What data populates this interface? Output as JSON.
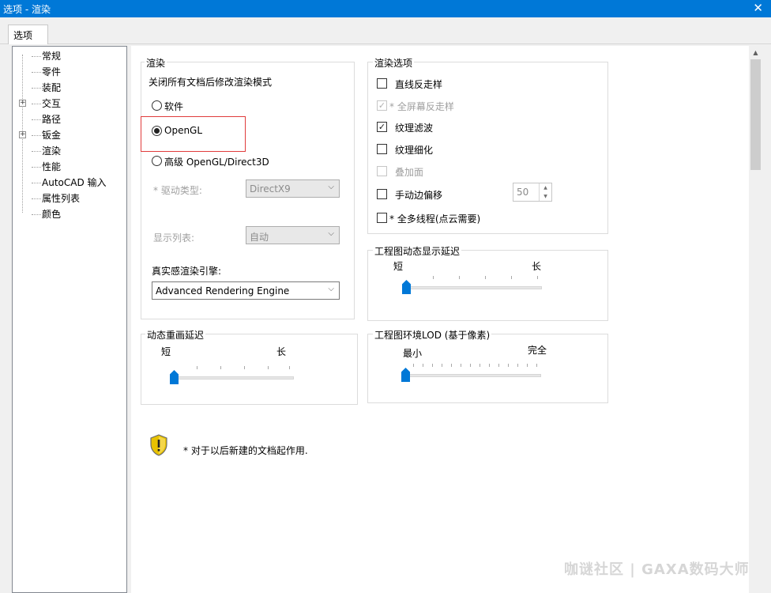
{
  "window": {
    "title": "选项 - 渲染",
    "close_glyph": "✕"
  },
  "tabs": [
    {
      "label": "选项"
    }
  ],
  "tree": {
    "items": [
      {
        "label": "常规",
        "expandable": false
      },
      {
        "label": "零件",
        "expandable": false
      },
      {
        "label": "装配",
        "expandable": false
      },
      {
        "label": "交互",
        "expandable": true
      },
      {
        "label": "路径",
        "expandable": false
      },
      {
        "label": "钣金",
        "expandable": true
      },
      {
        "label": "渲染",
        "expandable": false
      },
      {
        "label": "性能",
        "expandable": false
      },
      {
        "label": "AutoCAD 输入",
        "expandable": false
      },
      {
        "label": "属性列表",
        "expandable": false
      },
      {
        "label": "颜色",
        "expandable": false
      }
    ],
    "expander_glyph": "+"
  },
  "render_group": {
    "title": "渲染",
    "subtitle": "关闭所有文档后修改渲染模式",
    "radio_software": "软件",
    "radio_opengl": "OpenGL",
    "radio_advanced": "高级 OpenGL/Direct3D",
    "selected": "OpenGL",
    "driver_label": "* 驱动类型:",
    "driver_value": "DirectX9",
    "display_list_label": "显示列表:",
    "display_list_value": "自动",
    "engine_label": "真实感渲染引擎:",
    "engine_value": "Advanced Rendering Engine"
  },
  "render_options": {
    "title": "渲染选项",
    "items": [
      {
        "label": "直线反走样",
        "checked": false,
        "disabled": false
      },
      {
        "label": "* 全屏幕反走样",
        "checked": true,
        "disabled": true
      },
      {
        "label": "纹理滤波",
        "checked": true,
        "disabled": false
      },
      {
        "label": "纹理细化",
        "checked": false,
        "disabled": false
      },
      {
        "label": "叠加面",
        "checked": false,
        "disabled": true
      },
      {
        "label": "手动边偏移",
        "checked": false,
        "disabled": false
      },
      {
        "label": "* 全多线程(点云需要)",
        "checked": false,
        "disabled": false
      }
    ],
    "offset_value": "50",
    "check_glyph": "✓"
  },
  "drawing_delay": {
    "title": "工程图动态显示延迟",
    "min_label": "短",
    "max_label": "长",
    "value": 0
  },
  "redraw_delay": {
    "title": "动态重画延迟",
    "min_label": "短",
    "max_label": "长",
    "value": 0
  },
  "lod": {
    "title": "工程图环境LOD (基于像素)",
    "min_label": "最小",
    "max_label": "完全",
    "value": 0
  },
  "note": "* 对于以后新建的文档起作用.",
  "scroll_up_glyph": "▲",
  "spin_glyphs": {
    "up": "▲",
    "down": "▼"
  },
  "select_arrow_glyph": "⌵",
  "watermark": "咖谜社区 | GAXA数码大师"
}
